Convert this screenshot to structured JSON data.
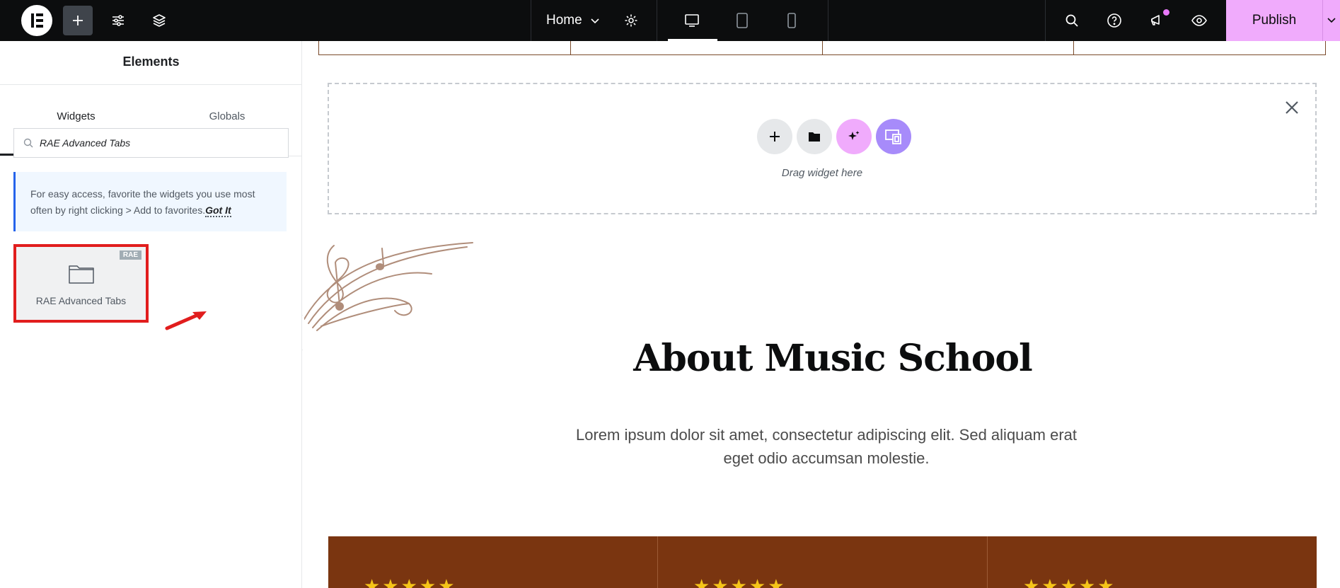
{
  "topbar": {
    "page_selector": "Home",
    "publish_label": "Publish",
    "icons": [
      "elementor-logo-icon",
      "add-icon",
      "settings-sliders-icon",
      "layers-icon",
      "chevron-down-icon",
      "gear-icon",
      "desktop-icon",
      "tablet-icon",
      "mobile-icon",
      "search-icon",
      "help-icon",
      "megaphone-icon",
      "eye-icon"
    ],
    "accent_color": "#f0abfc"
  },
  "panel": {
    "title": "Elements",
    "tabs": [
      {
        "label": "Widgets"
      },
      {
        "label": "Globals"
      }
    ],
    "search": {
      "value": "RAE Advanced Tabs"
    },
    "notice": {
      "text": "For easy access, favorite the widgets you use most often by right clicking > Add to favorites.",
      "action": "Got It"
    },
    "widgets": [
      {
        "label": "RAE Advanced Tabs",
        "badge": "RAE",
        "icon": "folder-icon"
      }
    ]
  },
  "canvas": {
    "dropzone": {
      "text": "Drag widget here"
    },
    "heading": "About Music School",
    "paragraph": "Lorem ipsum dolor sit amet, consectetur adipiscing elit. Sed aliquam erat eget odio accumsan molestie.",
    "ratings": [
      {
        "stars": 5
      },
      {
        "stars": 5
      },
      {
        "stars": 5
      }
    ],
    "brown_color": "#7a3510"
  }
}
